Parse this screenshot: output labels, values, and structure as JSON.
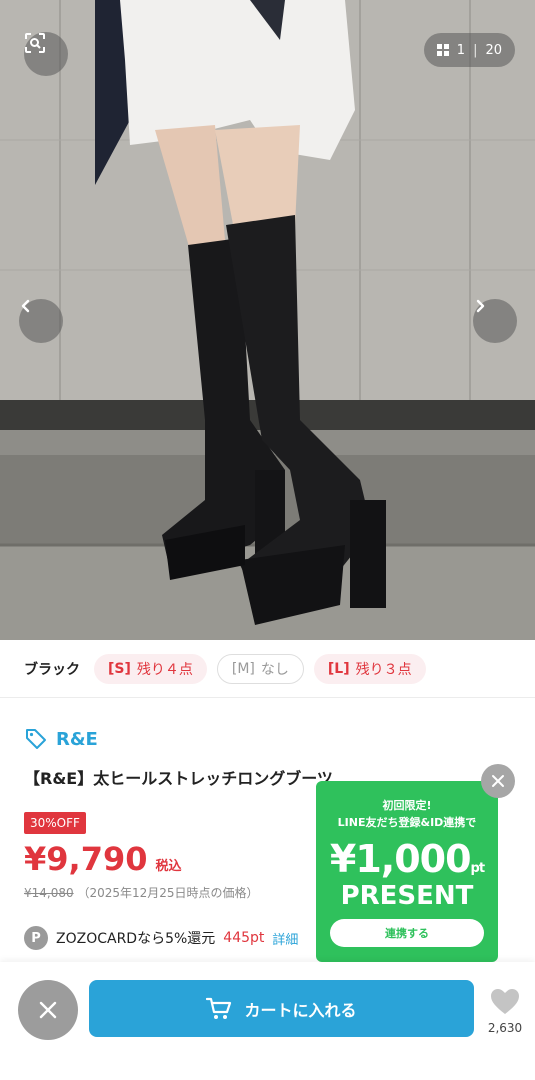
{
  "gallery": {
    "current": "1",
    "separator": "|",
    "total": "20"
  },
  "variant": {
    "color_name": "ブラック",
    "sizes": [
      {
        "size": "[S]",
        "stock": "残り４点"
      },
      {
        "size": "[M]",
        "stock": "なし"
      },
      {
        "size": "[L]",
        "stock": "残り３点"
      }
    ]
  },
  "product": {
    "brand": "R&E",
    "title": "【R&E】太ヒールストレッチロングブーツ",
    "discount_badge": "30%OFF",
    "price": "¥9,790",
    "tax_label": "税込",
    "original_price": "¥14,080",
    "price_date_note": "（2025年12月25日時点の価格）"
  },
  "points": {
    "badge": "P",
    "label": "ZOZOCARDなら5%還元",
    "amount": "445pt",
    "detail_link": "詳細"
  },
  "line_banner": {
    "line1": "初回限定!",
    "line2": "LINE友だち登録&ID連携で",
    "amount": "¥1,000",
    "unit": "pt",
    "present": "PRESENT",
    "button": "連携する"
  },
  "bottom_bar": {
    "cart_label": "カートに入れる",
    "favorite_count": "2,630"
  },
  "colors": {
    "accent_blue": "#2aa3d8",
    "sale_red": "#e0363e",
    "line_green": "#2fc15c"
  }
}
